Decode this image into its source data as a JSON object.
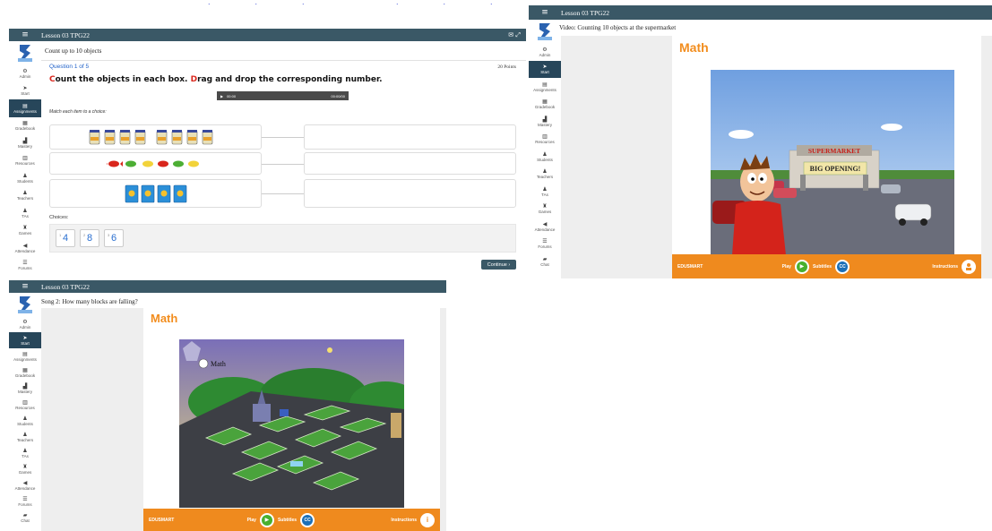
{
  "top_link_fragment": "... ...",
  "sidebar_items": [
    "Admin",
    "Start",
    "Assignments",
    "Gradebook",
    "Mastery",
    "Resources",
    "Students",
    "Teachers",
    "TAs",
    "Games",
    "Attendance",
    "Forums",
    "Chat"
  ],
  "panel1": {
    "lesson_title": "Lesson 03 TPG22",
    "page_title": "Count up to 10 objects",
    "question_label": "Question 1 of 5",
    "points": "20 Points",
    "instruction_c": "C",
    "instruction_part1": "ount the objects in each box. ",
    "instruction_d": "D",
    "instruction_part2": "rag and drop the corresponding number.",
    "audio_time_left": "00:00",
    "audio_time_right": "00:00/00",
    "match_hint": "Match each item to a choice:",
    "choices_label": "Choices:",
    "choices": [
      {
        "num": "4",
        "sub": "1"
      },
      {
        "num": "8",
        "sub": "2"
      },
      {
        "num": "6",
        "sub": "3"
      }
    ],
    "continue_label": "Continue",
    "continue_arrow": "›"
  },
  "panel2": {
    "lesson_title": "Lesson 03 TPG22",
    "page_title": "Video: Counting 10 objects at the supermarket",
    "math_label": "Math",
    "sign_supermarket": "SUPERMARKET",
    "sign_opening": "BIG OPENING!",
    "brand": "EDUSMART",
    "play_label": "Play",
    "subtitles_label": "Subtitles",
    "cc_label": "CC",
    "instructions_label": "Instructions"
  },
  "panel3": {
    "lesson_title": "Lesson 03 TPG22",
    "page_title": "Song 2: How many blocks are falling?",
    "math_label": "Math",
    "map_label": "Math",
    "brand": "EDUSMART",
    "play_label": "Play",
    "subtitles_label": "Subtitles",
    "cc_label": "CC",
    "instructions_label": "Instructions",
    "info_icon_glyph": "i"
  },
  "colors": {
    "topbar": "#3a5866",
    "accent_orange": "#ef8a1e",
    "math_orange": "#f28d1e",
    "instruction_red": "#d9261c",
    "choice_blue": "#2a6fd0",
    "active_nav": "#27465a"
  }
}
